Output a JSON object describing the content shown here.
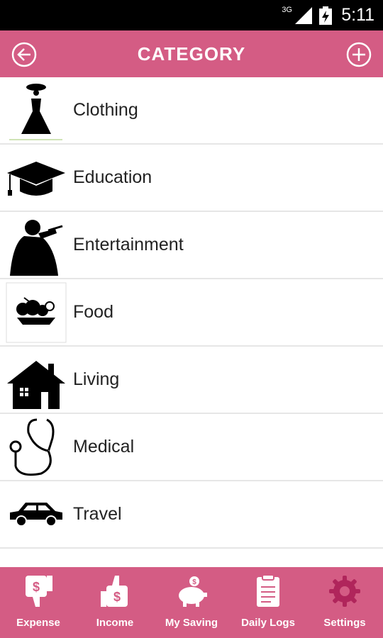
{
  "status_bar": {
    "network": "3G",
    "time": "5:11"
  },
  "header": {
    "title": "CATEGORY",
    "back_icon": "back-arrow-icon",
    "add_icon": "plus-icon"
  },
  "categories": [
    {
      "label": "Clothing",
      "icon": "dress-icon"
    },
    {
      "label": "Education",
      "icon": "graduation-cap-icon"
    },
    {
      "label": "Entertainment",
      "icon": "singer-icon"
    },
    {
      "label": "Food",
      "icon": "fruit-plate-icon"
    },
    {
      "label": "Living",
      "icon": "house-icon"
    },
    {
      "label": "Medical",
      "icon": "stethoscope-icon"
    },
    {
      "label": "Travel",
      "icon": "car-icon"
    }
  ],
  "bottom_nav": [
    {
      "label": "Expense",
      "icon": "thumbs-down-dollar-icon"
    },
    {
      "label": "Income",
      "icon": "thumbs-up-dollar-icon"
    },
    {
      "label": "My Saving",
      "icon": "piggy-bank-icon"
    },
    {
      "label": "Daily Logs",
      "icon": "clipboard-icon"
    },
    {
      "label": "Settings",
      "icon": "gear-icon",
      "active_color": "#b0255b"
    }
  ],
  "colors": {
    "brand": "#d45c84",
    "active": "#b0255b",
    "status_bar": "#000000"
  }
}
